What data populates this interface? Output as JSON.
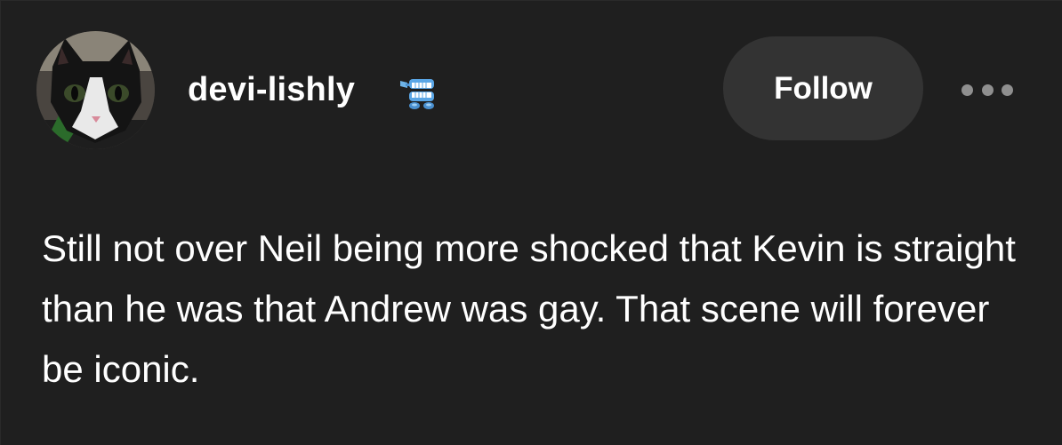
{
  "post": {
    "author": {
      "username": "devi-lishly",
      "avatar_icon": "cat-avatar",
      "badge_icon": "chattering-teeth-badge-icon"
    },
    "follow_label": "Follow",
    "more_icon": "more-options-icon",
    "body_text": "Still not over Neil being more shocked that Kevin is straight than he was that Andrew was gay. That scene will forever be iconic."
  },
  "colors": {
    "background": "#1f1f1f",
    "button_background": "#333333",
    "text": "#ffffff",
    "muted": "#8f8f8f"
  }
}
